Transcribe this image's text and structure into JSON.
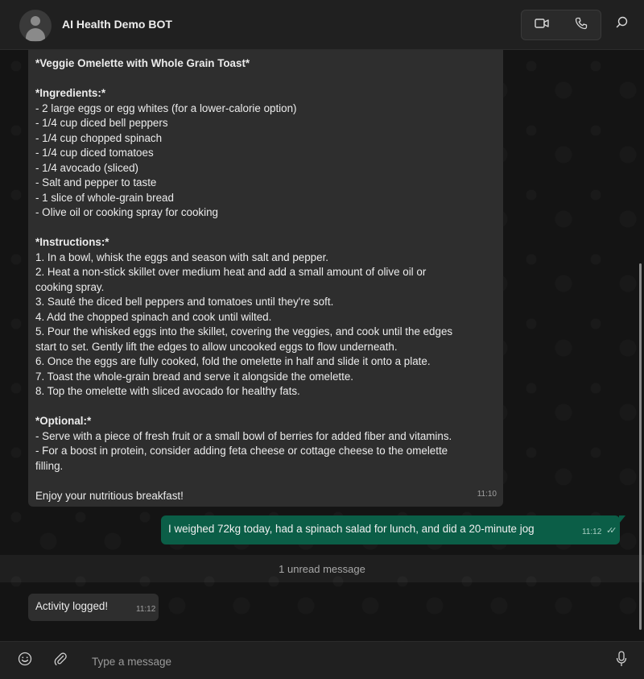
{
  "header": {
    "title": "AI Health Demo BOT",
    "video_icon": "video-call-icon",
    "phone_icon": "voice-call-icon",
    "search_icon": "search-icon"
  },
  "messages": {
    "incoming_recipe": {
      "lines": [
        {
          "text": "*Veggie Omelette with Whole Grain Toast*",
          "bold": true
        },
        {
          "text": "",
          "bold": false
        },
        {
          "text": "*Ingredients:*",
          "bold": true
        },
        {
          "text": "- 2 large eggs or egg whites (for a lower-calorie option)",
          "bold": false
        },
        {
          "text": "- 1/4 cup diced bell peppers",
          "bold": false
        },
        {
          "text": "- 1/4 cup chopped spinach",
          "bold": false
        },
        {
          "text": "- 1/4 cup diced tomatoes",
          "bold": false
        },
        {
          "text": "- 1/4 avocado (sliced)",
          "bold": false
        },
        {
          "text": "- Salt and pepper to taste",
          "bold": false
        },
        {
          "text": "- 1 slice of whole-grain bread",
          "bold": false
        },
        {
          "text": "- Olive oil or cooking spray for cooking",
          "bold": false
        },
        {
          "text": "",
          "bold": false
        },
        {
          "text": "*Instructions:*",
          "bold": true
        },
        {
          "text": "1. In a bowl, whisk the eggs and season with salt and pepper.",
          "bold": false
        },
        {
          "text": "2. Heat a non-stick skillet over medium heat and add a small amount of olive oil or",
          "bold": false
        },
        {
          "text": "cooking spray.",
          "bold": false
        },
        {
          "text": "3. Sauté the diced bell peppers and tomatoes until they're soft.",
          "bold": false
        },
        {
          "text": "4. Add the chopped spinach and cook until wilted.",
          "bold": false
        },
        {
          "text": "5. Pour the whisked eggs into the skillet, covering the veggies, and cook until the edges",
          "bold": false
        },
        {
          "text": "start to set. Gently lift the edges to allow uncooked eggs to flow underneath.",
          "bold": false
        },
        {
          "text": "6. Once the eggs are fully cooked, fold the omelette in half and slide it onto a plate.",
          "bold": false
        },
        {
          "text": "7. Toast the whole-grain bread and serve it alongside the omelette.",
          "bold": false
        },
        {
          "text": "8. Top the omelette with sliced avocado for healthy fats.",
          "bold": false
        },
        {
          "text": "",
          "bold": false
        },
        {
          "text": "*Optional:*",
          "bold": true
        },
        {
          "text": "- Serve with a piece of fresh fruit or a small bowl of berries for added fiber and vitamins.",
          "bold": false
        },
        {
          "text": "- For a boost in protein, consider adding feta cheese or cottage cheese to the omelette",
          "bold": false
        },
        {
          "text": "filling.",
          "bold": false
        },
        {
          "text": "",
          "bold": false
        },
        {
          "text": "Enjoy your nutritious breakfast!",
          "bold": false
        }
      ],
      "time": "11:10"
    },
    "outgoing": {
      "text": "I weighed 72kg today, had a spinach salad for lunch, and did a 20-minute jog",
      "time": "11:12",
      "ticks": "✓✓"
    },
    "unread_label": "1 unread message",
    "incoming_reply": {
      "text": "Activity logged!",
      "time": "11:12"
    }
  },
  "composer": {
    "placeholder": "Type a message",
    "emoji_icon": "emoji-icon",
    "attach_icon": "attach-icon",
    "mic_icon": "microphone-icon"
  },
  "colors": {
    "outgoing_bubble": "#0b5e47",
    "incoming_bubble": "#2e2e2e",
    "background": "#141414"
  }
}
